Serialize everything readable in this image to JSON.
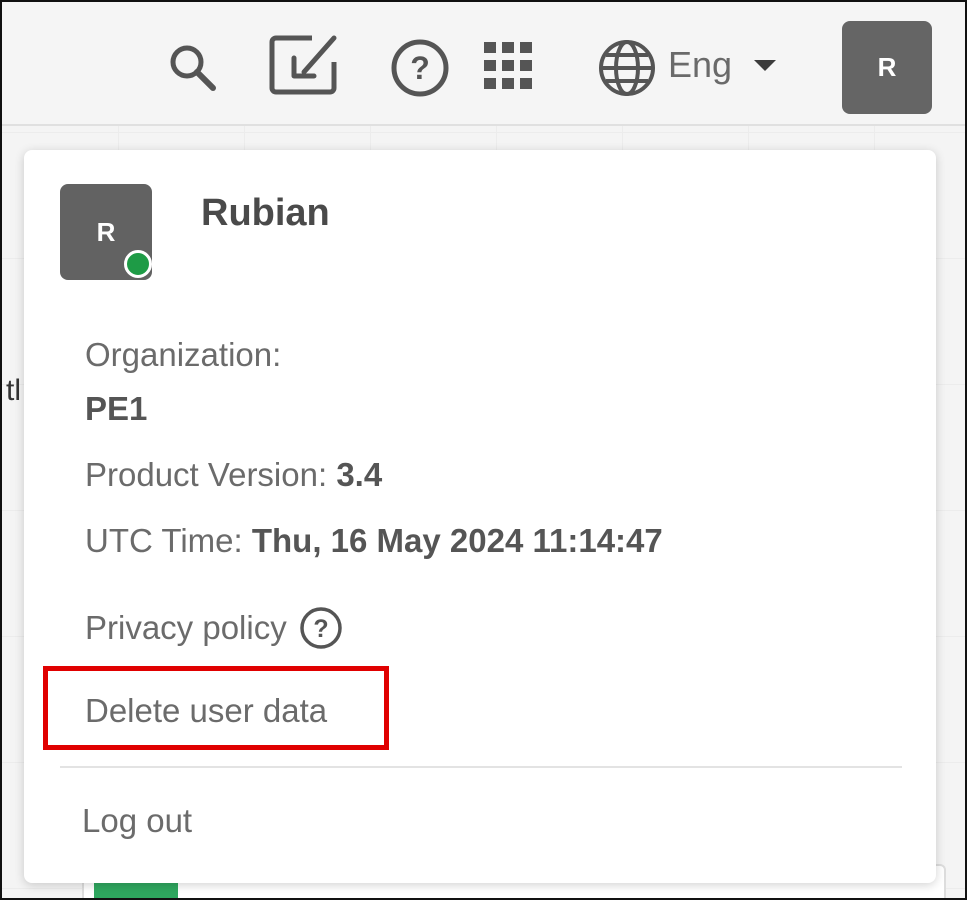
{
  "header": {
    "icons": [
      "search-icon",
      "checkin-icon",
      "help-icon",
      "apps-grid-icon",
      "globe-icon"
    ],
    "language": "Eng",
    "avatar_initial": "R"
  },
  "background": {
    "peek_text": "tl"
  },
  "user_menu": {
    "avatar_initial": "R",
    "status_color": "#1e9b46",
    "name": "Rubian",
    "organization_label": "Organization:",
    "organization_value": "PE1",
    "product_version_label": "Product Version:",
    "product_version_value": "3.4",
    "utc_time_label": "UTC Time:",
    "utc_time_value": "Thu, 16 May 2024 11:14:47",
    "privacy_policy": "Privacy policy",
    "delete_user_data": "Delete user data",
    "log_out": "Log out",
    "highlight_color": "#e00000"
  }
}
